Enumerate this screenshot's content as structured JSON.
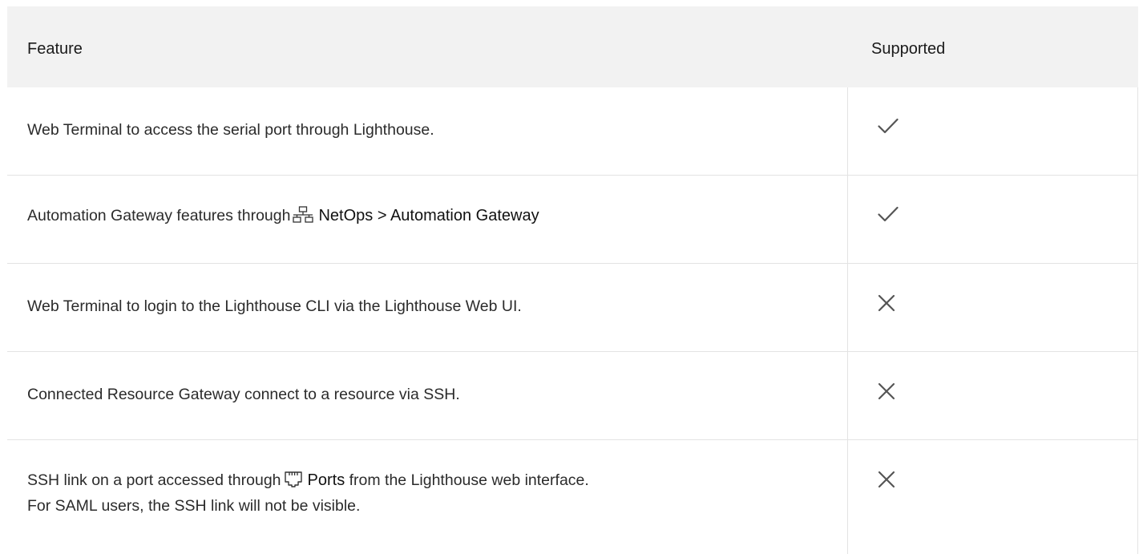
{
  "table": {
    "headers": {
      "feature": "Feature",
      "supported": "Supported"
    },
    "rows": [
      {
        "feature": "Web Terminal to access the serial port through Lighthouse.",
        "supported": true,
        "icon": "checkmark-icon"
      },
      {
        "feature_prefix": "Automation Gateway features through",
        "nav_icon": "network-topology-icon",
        "nav_label": "NetOps > Automation Gateway",
        "supported": true,
        "icon": "checkmark-icon"
      },
      {
        "feature": "Web Terminal to login to the Lighthouse CLI via the Lighthouse Web UI.",
        "supported": false,
        "icon": "cross-icon"
      },
      {
        "feature": "Connected Resource Gateway connect to a resource via SSH.",
        "supported": false,
        "icon": "cross-icon"
      },
      {
        "feature_prefix": "SSH link on a port accessed through",
        "nav_icon": "ethernet-port-icon",
        "nav_label": "Ports",
        "feature_suffix": "from the Lighthouse web interface.",
        "feature_line2": "For SAML users, the SSH link will not be visible.",
        "supported": false,
        "icon": "cross-icon"
      }
    ]
  },
  "colors": {
    "header_bg": "#f2f2f2",
    "grid": "#e3e3e3",
    "text": "#2b2b2b",
    "icon": "#555555"
  }
}
